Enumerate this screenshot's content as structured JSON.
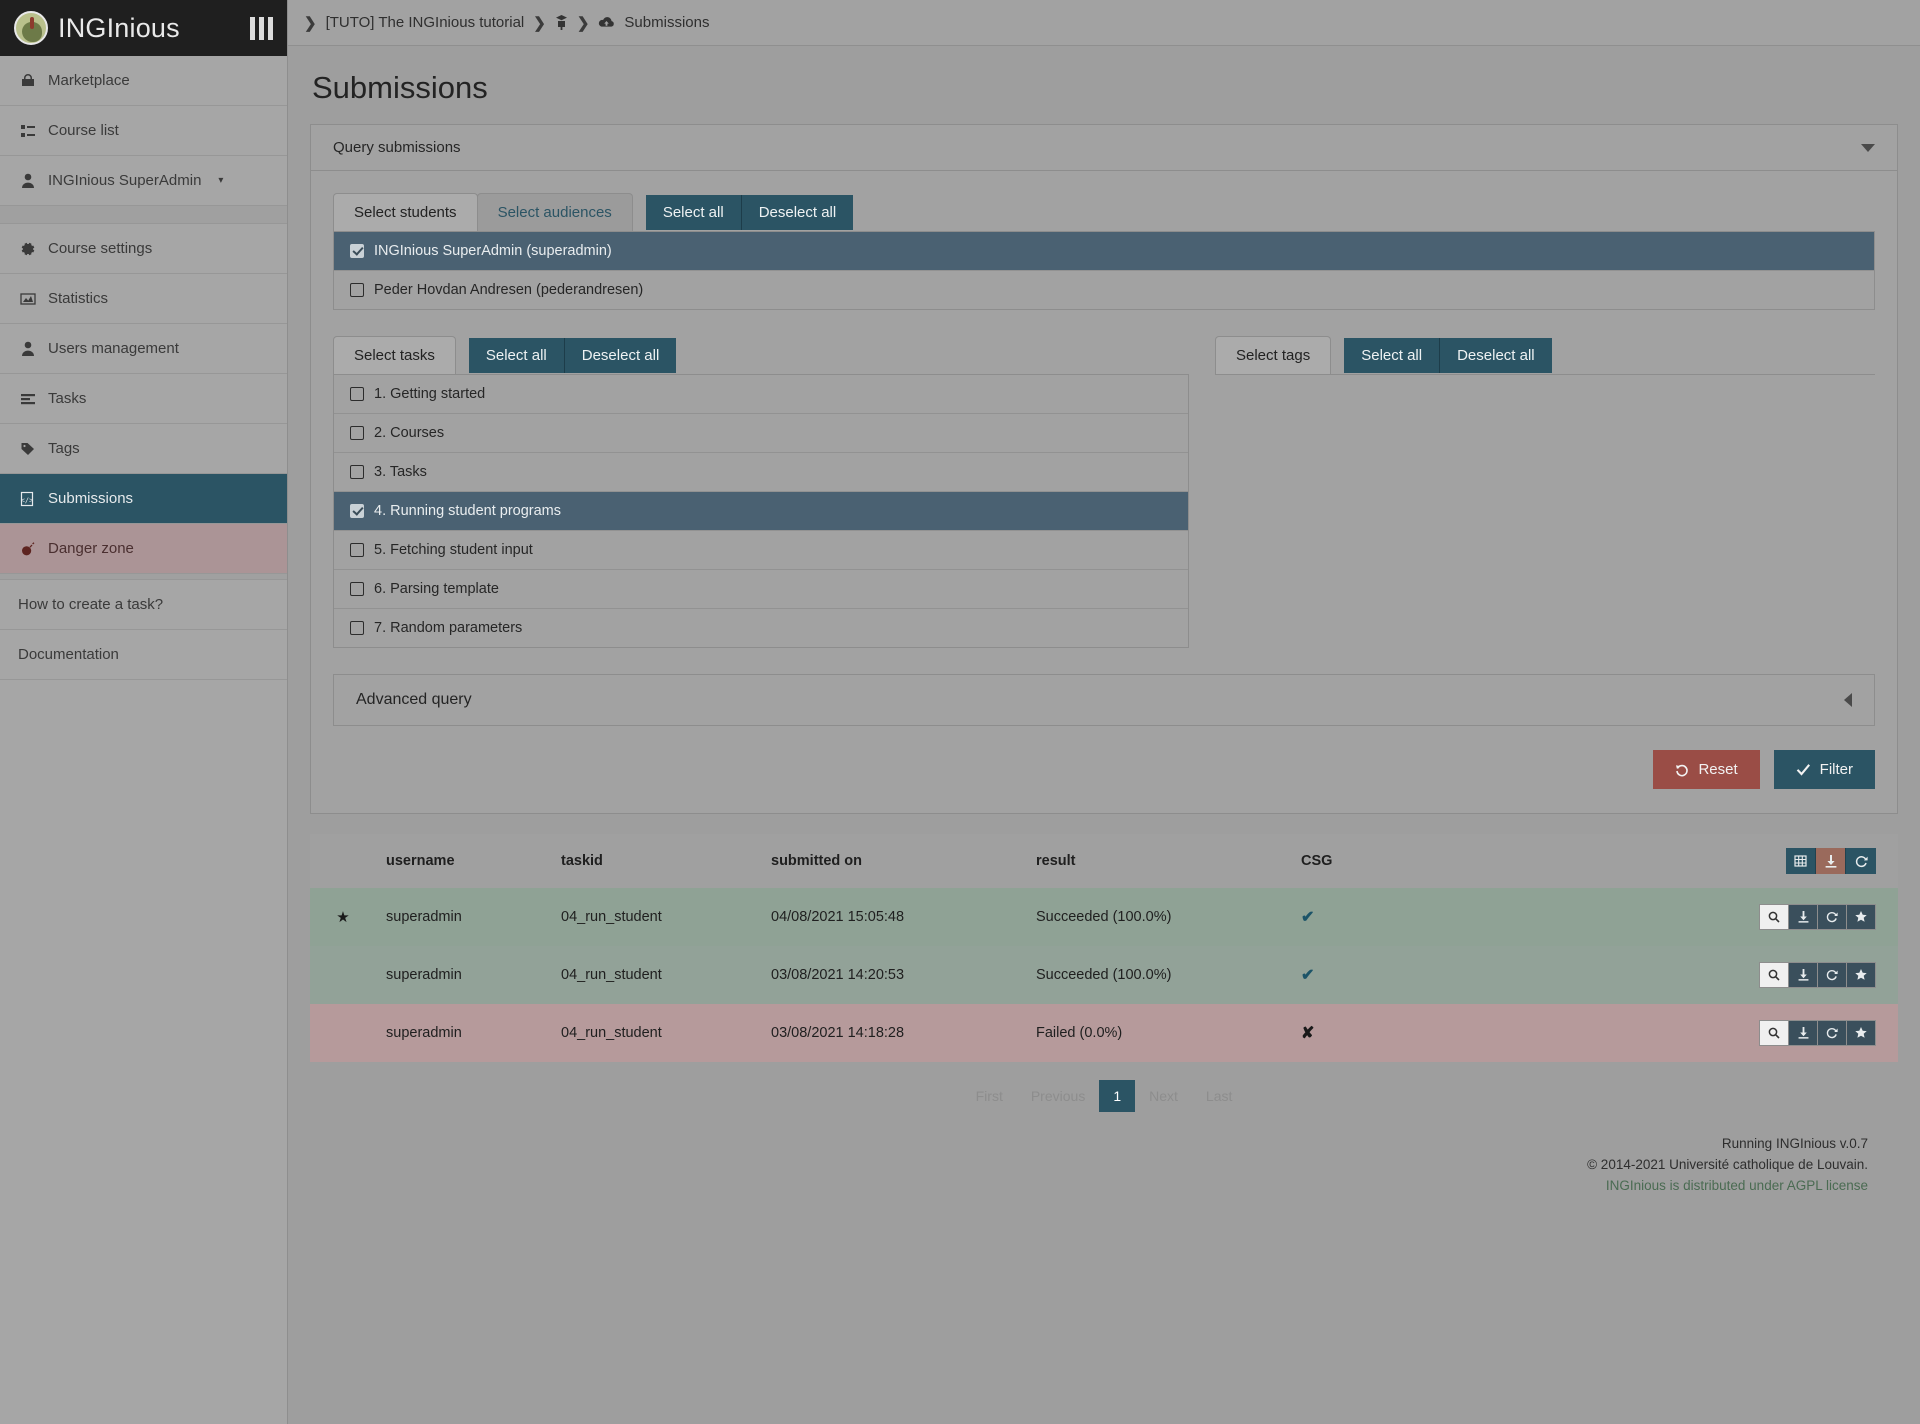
{
  "brand": {
    "name": "INGInious",
    "logo_icon": "owl-logo-icon",
    "bars_icon": "menu-bars-icon"
  },
  "sidebar": {
    "items": [
      {
        "label": "Marketplace",
        "icon": "shop-icon",
        "state": "plain"
      },
      {
        "label": "Course list",
        "icon": "list-icon",
        "state": "plain"
      },
      {
        "label": "INGInious SuperAdmin",
        "icon": "user-icon",
        "state": "plain",
        "caret": "▾"
      }
    ],
    "course_items": [
      {
        "label": "Course settings",
        "icon": "gear-icon",
        "state": "plain"
      },
      {
        "label": "Statistics",
        "icon": "chart-icon",
        "state": "plain"
      },
      {
        "label": "Users management",
        "icon": "user-icon",
        "state": "plain"
      },
      {
        "label": "Tasks",
        "icon": "tasks-icon",
        "state": "plain"
      },
      {
        "label": "Tags",
        "icon": "tag-icon",
        "state": "plain"
      },
      {
        "label": "Submissions",
        "icon": "submission-icon",
        "state": "active"
      },
      {
        "label": "Danger zone",
        "icon": "bomb-icon",
        "state": "danger"
      }
    ],
    "help_items": [
      {
        "label": "How to create a task?"
      },
      {
        "label": "Documentation"
      }
    ]
  },
  "breadcrumb": {
    "sep": "❯",
    "course": "[TUTO] The INGInious tutorial",
    "admin_icon": "admin-lock-icon",
    "page_icon": "cloud-upload-icon",
    "page": "Submissions"
  },
  "page": {
    "title": "Submissions"
  },
  "query_card": {
    "header": "Query submissions",
    "collapse_icon": "chevron-down-icon"
  },
  "students": {
    "tabs": [
      {
        "label": "Select students",
        "active": true
      },
      {
        "label": "Select audiences",
        "active": false
      }
    ],
    "select_all": "Select all",
    "deselect_all": "Deselect all",
    "rows": [
      {
        "label": "INGInious SuperAdmin (superadmin)",
        "checked": true
      },
      {
        "label": "Peder Hovdan Andresen (pederandresen)",
        "checked": false
      }
    ]
  },
  "tasks": {
    "tab": "Select tasks",
    "select_all": "Select all",
    "deselect_all": "Deselect all",
    "rows": [
      {
        "label": "1. Getting started",
        "checked": false
      },
      {
        "label": "2. Courses",
        "checked": false
      },
      {
        "label": "3. Tasks",
        "checked": false
      },
      {
        "label": "4. Running student programs",
        "checked": true
      },
      {
        "label": "5. Fetching student input",
        "checked": false
      },
      {
        "label": "6. Parsing template",
        "checked": false
      },
      {
        "label": "7. Random parameters",
        "checked": false
      }
    ]
  },
  "tags": {
    "tab": "Select tags",
    "select_all": "Select all",
    "deselect_all": "Deselect all",
    "rows": []
  },
  "advanced": {
    "label": "Advanced query",
    "collapse_icon": "chevron-left-icon"
  },
  "actions": {
    "reset": "Reset",
    "reset_icon": "undo-icon",
    "filter": "Filter",
    "filter_icon": "check-icon"
  },
  "table": {
    "headers": [
      "username",
      "taskid",
      "submitted on",
      "result",
      "CSG"
    ],
    "header_buttons": [
      {
        "icon": "table-icon",
        "style": "teal"
      },
      {
        "icon": "download-icon",
        "style": "brown"
      },
      {
        "icon": "refresh-icon",
        "style": "teal"
      }
    ],
    "row_buttons": [
      {
        "icon": "search-icon",
        "style": "light"
      },
      {
        "icon": "download-icon",
        "style": "dark"
      },
      {
        "icon": "refresh-icon",
        "style": "dark"
      },
      {
        "icon": "star-icon",
        "style": "dark"
      }
    ],
    "rows": [
      {
        "starred": true,
        "star": "★",
        "username": "superadmin",
        "taskid": "04_run_student",
        "submitted_on": "04/08/2021 15:05:48",
        "result": "Succeeded (100.0%)",
        "csg": "✔",
        "status": "ok"
      },
      {
        "starred": false,
        "star": "",
        "username": "superadmin",
        "taskid": "04_run_student",
        "submitted_on": "03/08/2021 14:20:53",
        "result": "Succeeded (100.0%)",
        "csg": "✔",
        "status": "ok2"
      },
      {
        "starred": false,
        "star": "",
        "username": "superadmin",
        "taskid": "04_run_student",
        "submitted_on": "03/08/2021 14:18:28",
        "result": "Failed (0.0%)",
        "csg": "✘",
        "status": "fail"
      }
    ]
  },
  "pagination": {
    "first": "First",
    "previous": "Previous",
    "current": "1",
    "next": "Next",
    "last": "Last"
  },
  "footer": {
    "version": "Running INGInious v.0.7",
    "copyright": "© 2014-2021 Université catholique de Louvain.",
    "license": "INGInious is distributed under AGPL license"
  },
  "colors": {
    "teal": "#2b5464",
    "danger": "#9a4d46",
    "selected_row": "#4a6172"
  }
}
